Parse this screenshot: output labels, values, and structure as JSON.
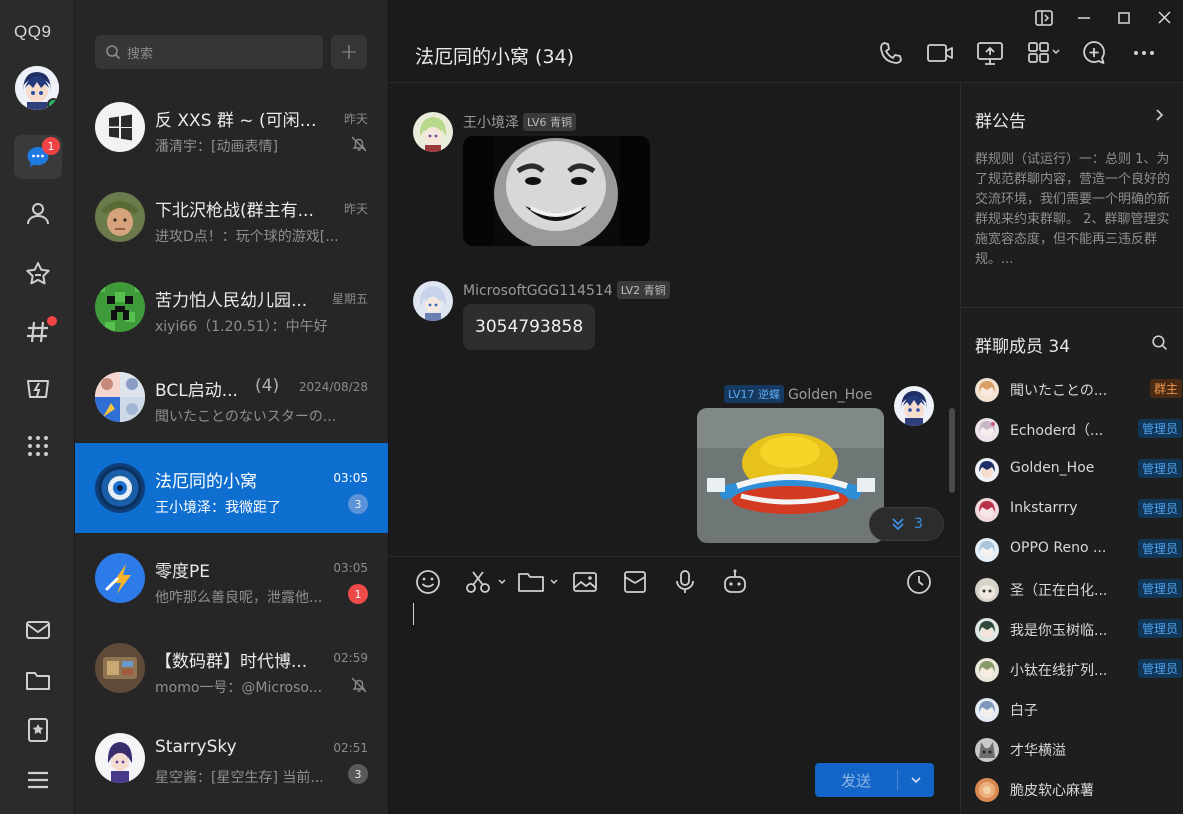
{
  "app": {
    "logo": "QQ9"
  },
  "rail": {
    "messages_badge": "1"
  },
  "search": {
    "placeholder": "搜索"
  },
  "add_label": "+",
  "conversations": [
    {
      "name": "反 XXS 群 ~ (可闲聊)",
      "time": "昨天",
      "preview": "潘清宇：[动画表情]",
      "muted": true
    },
    {
      "name": "下北沢枪战(群主有...",
      "time": "昨天",
      "preview": "进攻D点！：玩个球的游戏[..."
    },
    {
      "name": "苦力怕人民幼儿园...",
      "time": "星期五",
      "preview": "xiyi66（1.20.51）：中午好"
    },
    {
      "name": "BCL启动...",
      "count": "(4)",
      "time": "2024/08/28",
      "preview": "聞いたことのないスターの..."
    },
    {
      "name": "法厄同的小窝",
      "time": "03:05",
      "preview": "王小境泽：我微距了",
      "badge": "3",
      "active": true
    },
    {
      "name": "零度PE",
      "time": "03:05",
      "preview": "他咋那么善良呢，泄露他...",
      "badge": "1"
    },
    {
      "name": "【数码群】时代博...",
      "time": "02:59",
      "preview": "momo一号：@Microso...",
      "muted": true
    },
    {
      "name": "StarrySky",
      "time": "02:51",
      "preview": "星空酱：[星空生存] 当前...",
      "badge": "3"
    }
  ],
  "chat": {
    "title": "法厄同的小窝 (34)",
    "messages": [
      {
        "sender": "王小境泽",
        "level": "LV6 青铜"
      },
      {
        "sender": "MicrosoftGGG114514",
        "level": "LV2 青铜",
        "text": "3054793858"
      },
      {
        "sender": "Golden_Hoe",
        "level": "LV17 逆蝶"
      }
    ],
    "jump_count": "3",
    "send_label": "发送"
  },
  "panel": {
    "notice_title": "群公告",
    "notice_text": "群规则（试运行）一：总则 1、为了规范群聊内容，营造一个良好的交流环境，我们需要一个明确的新群规来约束群聊。 2、群聊管理实施宽容态度，但不能再三违反群规。...",
    "members_title": "群聊成员 34",
    "members": [
      {
        "name": "聞いたことの...",
        "role": "群主"
      },
      {
        "name": "Echoderd（...",
        "role": "管理员"
      },
      {
        "name": "Golden_Hoe",
        "role": "管理员"
      },
      {
        "name": "Inkstarrry",
        "role": "管理员"
      },
      {
        "name": "OPPO Reno ...",
        "role": "管理员"
      },
      {
        "name": "圣（正在白化...",
        "role": "管理员"
      },
      {
        "name": "我是你玉树临...",
        "role": "管理员"
      },
      {
        "name": "小钛在线扩列...",
        "role": "管理员"
      },
      {
        "name": "白子"
      },
      {
        "name": "才华横溢"
      },
      {
        "name": "脆皮软心麻薯"
      }
    ]
  },
  "colors": {
    "accent": "#0f6fd1",
    "badge": "#f04444",
    "online": "#1dbf5e"
  }
}
